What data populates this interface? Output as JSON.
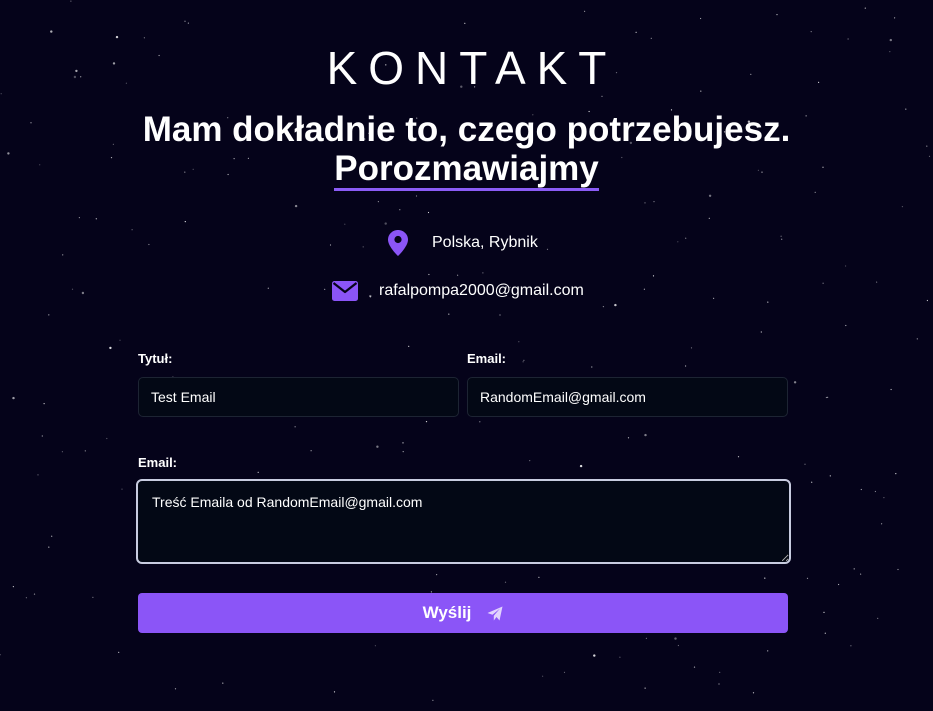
{
  "section": {
    "heading": "KONTAKT",
    "subheading": "Mam dokładnie to, czego potrzebujesz.",
    "cta_link": "Porozmawiajmy"
  },
  "contact_info": {
    "location": {
      "icon": "map-pin-icon",
      "text": "Polska, Rybnik"
    },
    "email": {
      "icon": "envelope-icon",
      "text": "rafalpompa2000@gmail.com"
    }
  },
  "form": {
    "title_label": "Tytuł:",
    "title_value": "Test Email",
    "email_label": "Email:",
    "email_value": "RandomEmail@gmail.com",
    "message_label": "Email:",
    "message_value": "Treść Emaila od RandomEmail@gmail.com",
    "submit_label": "Wyślij",
    "submit_icon": "paper-plane-icon"
  },
  "colors": {
    "background": "#05031a",
    "accent": "#8b55f7",
    "field_background": "#030815"
  }
}
